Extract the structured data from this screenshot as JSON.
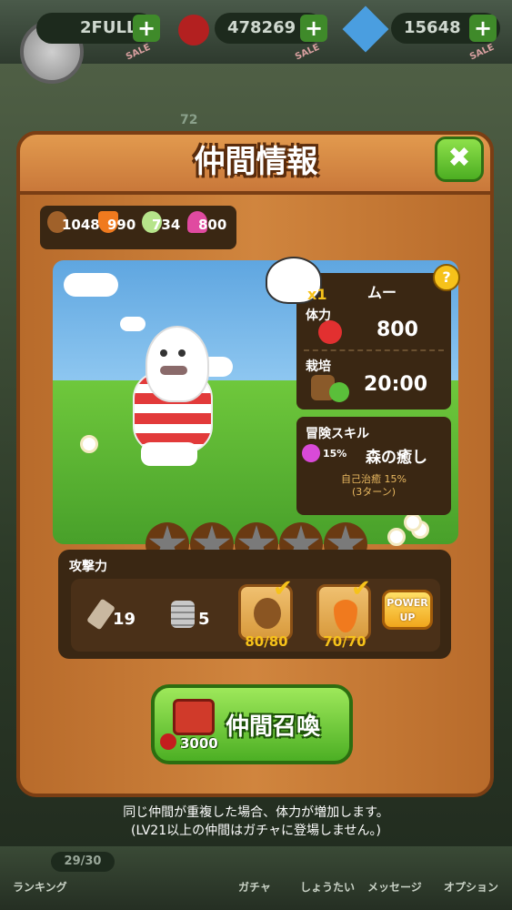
{
  "header": {
    "lives_label": "FULL",
    "lives_prefix": "2",
    "cherries": "478269",
    "gems": "15648",
    "sale_label": "SALE",
    "level_badge": "72"
  },
  "dialog": {
    "title": "仲間情報",
    "close_icon": "close-icon"
  },
  "resources": [
    {
      "icon": "acorn-icon",
      "value": "1048",
      "color": "#a0612a"
    },
    {
      "icon": "carrot-icon",
      "value": "990",
      "color": "#f07a1e"
    },
    {
      "icon": "turnip-icon",
      "value": "734",
      "color": "#b6e48a"
    },
    {
      "icon": "mushroom-icon",
      "value": "800",
      "color": "#e04aa0"
    }
  ],
  "friend": {
    "name": "ムー",
    "multiplier": "x1",
    "hp_label": "体力",
    "hp_value": "800",
    "cultivate_label": "栽培",
    "cultivate_value": "20:00",
    "skill_section_label": "冒険スキル",
    "skill_chance": "15%",
    "skill_name": "森の癒し",
    "skill_desc_line1": "自己治癒 15%",
    "skill_desc_line2": "(3ターン)",
    "stars_total": 5,
    "stars_filled": 0
  },
  "attack": {
    "label": "攻撃力",
    "sword_value": "19",
    "coins_value": "5",
    "acorn_progress": "80/80",
    "carrot_progress": "70/70",
    "powerup_line1": "POWER",
    "powerup_line2": "UP"
  },
  "summon": {
    "label": "仲間召喚",
    "cost": "3000"
  },
  "note": {
    "line1": "同じ仲間が重複した場合、体力が増加します。",
    "line2": "(LV21以上の仲間はガチャに登場しません。)"
  },
  "bottom": {
    "stamina": "29/30",
    "nav": [
      "ランキング",
      "ガチャ",
      "しょうたい",
      "メッセージ",
      "オプション"
    ]
  },
  "colors": {
    "panel": "#c47a36",
    "panel_border": "#7a3e14",
    "dark_card": "#3a2713",
    "green_button": "#4caf24",
    "accent_yellow": "#f6c21a"
  }
}
